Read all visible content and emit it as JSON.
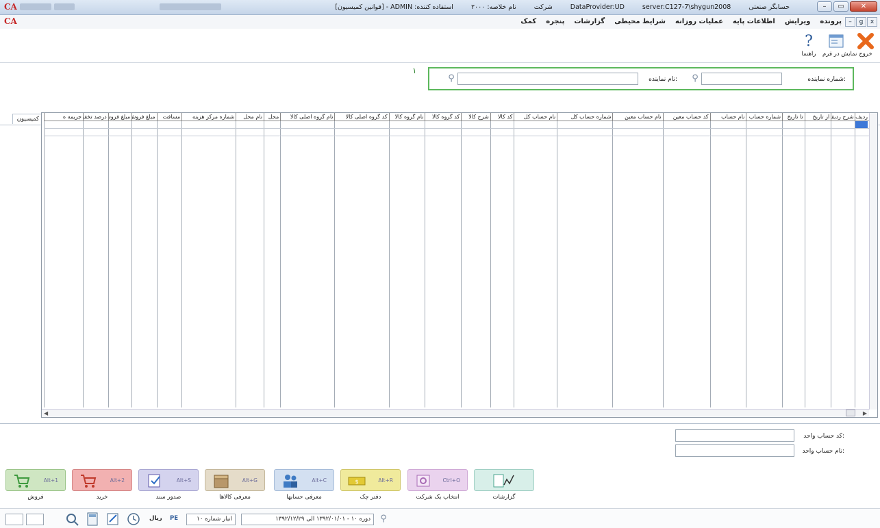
{
  "window": {
    "title_parts": [
      "حسابگر صنعتی",
      "server:C127-7\\shygun2008",
      "DataProvider:UD",
      "شرکت",
      "نام خلاصه: ۲۰۰۰",
      "استفاده کننده: ADMIN - [قوانین کمیسیون]"
    ],
    "controls": {
      "minimize": "–",
      "restore": "▭",
      "close": "✕"
    }
  },
  "menubar": {
    "logo": "CA",
    "items": [
      "پرونده",
      "ویرایش",
      "اطلاعات پایه",
      "عملیات روزانه",
      "شرایط محیطی",
      "گزارشات",
      "پنجره",
      "کمک"
    ],
    "mdi_controls": {
      "close": "x",
      "restore": "ǥ",
      "minimize": "–"
    }
  },
  "toolbar": {
    "exit": "خروج",
    "form_view": "نمایش در فرم",
    "help": "راهنما"
  },
  "filter": {
    "rep_number_label": "شماره نماینده:",
    "rep_name_label": "نام نماینده:",
    "annotation": "۱"
  },
  "tab": {
    "label": "قوانین کمیسیون"
  },
  "grid": {
    "columns": [
      "ردیف",
      "شرح ردیف",
      "از تاریخ",
      "تا تاریخ",
      "شماره حساب",
      "نام حساب",
      "کد حساب معین",
      "نام حساب معین",
      "شماره حساب کل",
      "نام حساب کل",
      "کد کالا",
      "شرح کالا",
      "کد گروه کالا",
      "نام گروه کالا",
      "کد گروه اصلی کالا",
      "نام گروه اصلی کالا",
      "محل",
      "نام محل",
      "شماره مرکز هزینه",
      "مسافت",
      "مبلغ فروش",
      "مبلغ فروش",
      "درصد تخفیف",
      "جریمه ه"
    ]
  },
  "bottom_fields": {
    "unit_code_label": "کد حساب واحد:",
    "unit_name_label": "نام حساب واحد:"
  },
  "shortcuts": [
    {
      "name": "فروش",
      "key": "Alt+1",
      "color": "#cfe6c2",
      "border": "#9cc58a",
      "icon": "cart-icon"
    },
    {
      "name": "خرید",
      "key": "Alt+2",
      "color": "#f2b1b1",
      "border": "#d58787",
      "icon": "cart-icon"
    },
    {
      "name": "صدور سند",
      "key": "Alt+S",
      "color": "#d4d3ee",
      "border": "#a9a7d2",
      "icon": "document-check-icon"
    },
    {
      "name": "معرفی کالاها",
      "key": "Alt+G",
      "color": "#e5dcc9",
      "border": "#c4b89c",
      "icon": "box-icon"
    },
    {
      "name": "معرفی حسابها",
      "key": "Alt+C",
      "color": "#d3e0f1",
      "border": "#a6bcd9",
      "icon": "people-icon"
    },
    {
      "name": "دفتر چک",
      "key": "Alt+R",
      "color": "#f0ea9c",
      "border": "#d0c66a",
      "icon": "cheque-icon"
    },
    {
      "name": "انتخاب یک شرکت",
      "key": "Ctrl+O",
      "color": "#ead3ee",
      "border": "#cfa9d6",
      "icon": "company-icon"
    },
    {
      "name": "گزارشات",
      "key": "",
      "color": "#d8efe9",
      "border": "#9fcfc3",
      "icon": "chart-icon"
    }
  ],
  "statusbar": {
    "period": "دوره ۱۰ - ۱۳۹۲/۰۱/۰۱ الی ۱۳۹۲/۱۲/۲۹",
    "warehouse": "انبار شماره ۱۰",
    "currency": "ریال",
    "pe": "PE"
  }
}
